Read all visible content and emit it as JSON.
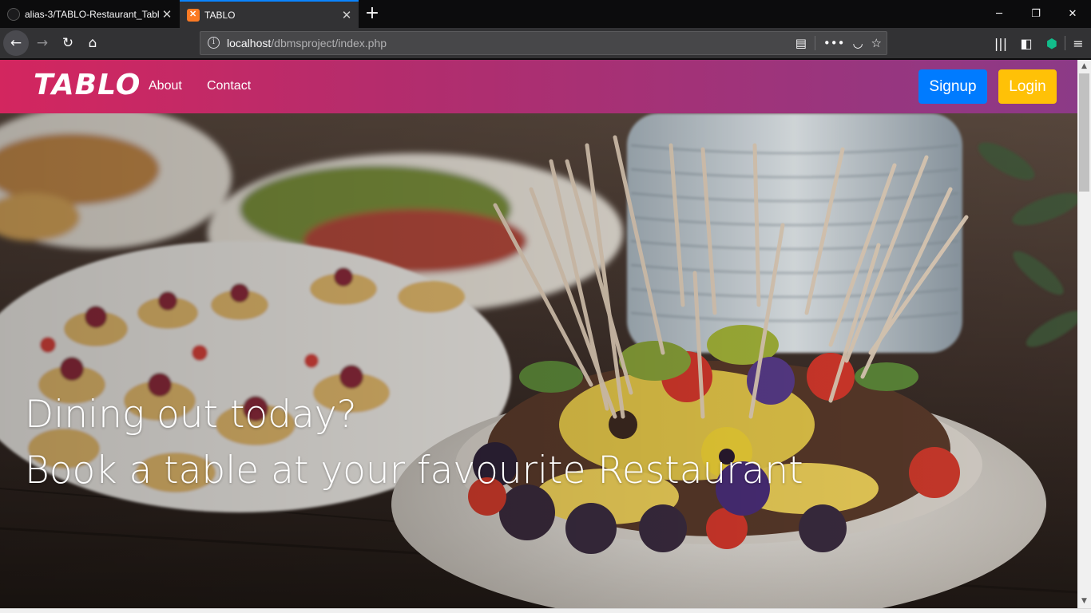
{
  "browser": {
    "tabs": [
      {
        "title": "alias-3/TABLO-Restaurant_Tabl",
        "active": false
      },
      {
        "title": "TABLO",
        "active": true
      }
    ],
    "url": {
      "host": "localhost",
      "path": "/dbmsproject/index.php"
    },
    "accent_color": "#0a84ff"
  },
  "site": {
    "brand": "TABLO",
    "nav": {
      "about": "About",
      "contact": "Contact"
    },
    "buttons": {
      "signup": "Signup",
      "login": "Login"
    },
    "colors": {
      "nav_start": "#d3265f",
      "nav_end": "#8c3a87",
      "signup": "#007bff",
      "login": "#ffc107"
    }
  },
  "hero": {
    "line1": "Dining out today?",
    "line2": "Book a table at your favourite Restaurant"
  }
}
